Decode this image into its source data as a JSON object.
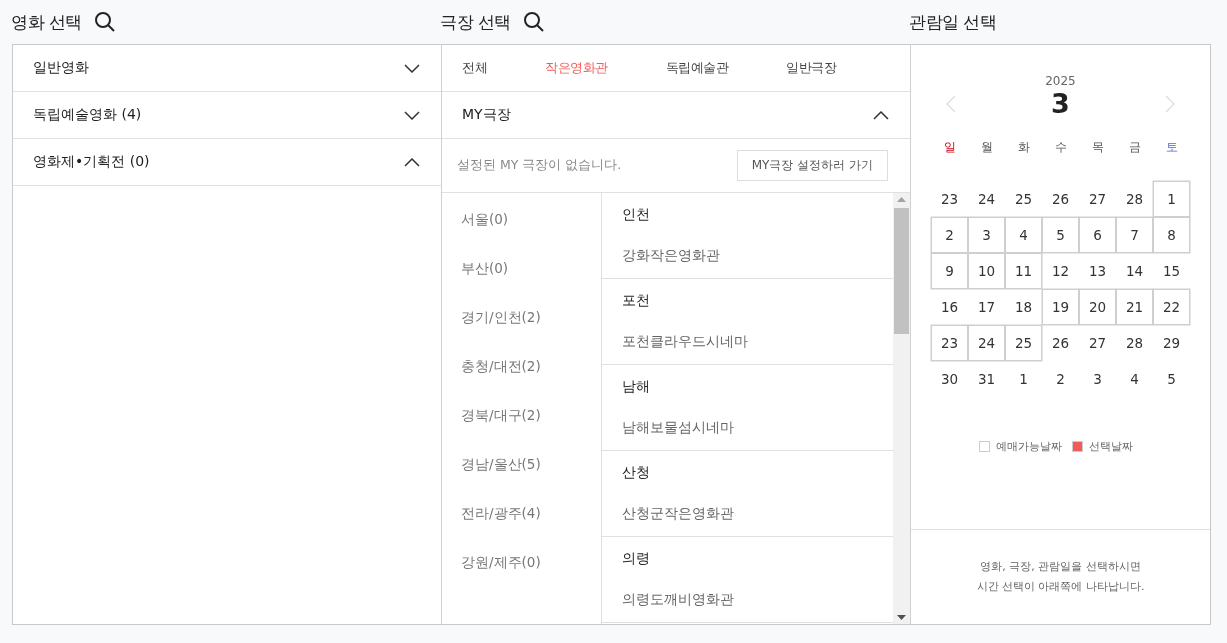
{
  "movie_panel": {
    "title": "영화 선택",
    "sections": [
      {
        "label": "일반영화",
        "expanded": false
      },
      {
        "label": "독립예술영화 (4)",
        "expanded": false
      },
      {
        "label": "영화제•기획전 (0)",
        "expanded": true
      }
    ]
  },
  "theater_panel": {
    "title": "극장 선택",
    "tabs": [
      {
        "label": "전체",
        "selected": false
      },
      {
        "label": "작은영화관",
        "selected": true
      },
      {
        "label": "독립예술관",
        "selected": false
      },
      {
        "label": "일반극장",
        "selected": false
      }
    ],
    "my_theater": {
      "label": "MY극장",
      "expanded": true,
      "notice": "설정된 MY 극장이 없습니다.",
      "button": "MY극장 설정하러 가기"
    },
    "regions": [
      {
        "label": "서울(0)",
        "selected": false
      },
      {
        "label": "부산(0)",
        "selected": false
      },
      {
        "label": "경기/인천(2)",
        "selected": false
      },
      {
        "label": "충청/대전(2)",
        "selected": false
      },
      {
        "label": "경북/대구(2)",
        "selected": false
      },
      {
        "label": "경남/울산(5)",
        "selected": false
      },
      {
        "label": "전라/광주(4)",
        "selected": false
      },
      {
        "label": "강원/제주(0)",
        "selected": false
      }
    ],
    "theaters": [
      {
        "area": "인천",
        "name": "강화작은영화관"
      },
      {
        "area": "포천",
        "name": "포천클라우드시네마"
      },
      {
        "area": "남해",
        "name": "남해보물섬시네마"
      },
      {
        "area": "산청",
        "name": "산청군작은영화관"
      },
      {
        "area": "의령",
        "name": "의령도깨비영화관"
      }
    ]
  },
  "date_panel": {
    "title": "관람일 선택",
    "year": "2025",
    "month": "3",
    "weekdays": [
      {
        "label": "일",
        "kind": "sunday"
      },
      {
        "label": "월",
        "kind": "weekday"
      },
      {
        "label": "화",
        "kind": "weekday"
      },
      {
        "label": "수",
        "kind": "weekday"
      },
      {
        "label": "목",
        "kind": "weekday"
      },
      {
        "label": "금",
        "kind": "weekday"
      },
      {
        "label": "토",
        "kind": "saturday"
      }
    ],
    "days": [
      {
        "label": "23",
        "available": false
      },
      {
        "label": "24",
        "available": false
      },
      {
        "label": "25",
        "available": false
      },
      {
        "label": "26",
        "available": false
      },
      {
        "label": "27",
        "available": false
      },
      {
        "label": "28",
        "available": false
      },
      {
        "label": "1",
        "available": true
      },
      {
        "label": "2",
        "available": true
      },
      {
        "label": "3",
        "available": true
      },
      {
        "label": "4",
        "available": true
      },
      {
        "label": "5",
        "available": true
      },
      {
        "label": "6",
        "available": true
      },
      {
        "label": "7",
        "available": true
      },
      {
        "label": "8",
        "available": true
      },
      {
        "label": "9",
        "available": true
      },
      {
        "label": "10",
        "available": true
      },
      {
        "label": "11",
        "available": true
      },
      {
        "label": "12",
        "available": false
      },
      {
        "label": "13",
        "available": false
      },
      {
        "label": "14",
        "available": false
      },
      {
        "label": "15",
        "available": false
      },
      {
        "label": "16",
        "available": false
      },
      {
        "label": "17",
        "available": false
      },
      {
        "label": "18",
        "available": false
      },
      {
        "label": "19",
        "available": true
      },
      {
        "label": "20",
        "available": true
      },
      {
        "label": "21",
        "available": true
      },
      {
        "label": "22",
        "available": true
      },
      {
        "label": "23",
        "available": true
      },
      {
        "label": "24",
        "available": true
      },
      {
        "label": "25",
        "available": true
      },
      {
        "label": "26",
        "available": false
      },
      {
        "label": "27",
        "available": false
      },
      {
        "label": "28",
        "available": false
      },
      {
        "label": "29",
        "available": false
      },
      {
        "label": "30",
        "available": false
      },
      {
        "label": "31",
        "available": false
      },
      {
        "label": "1",
        "available": false
      },
      {
        "label": "2",
        "available": false
      },
      {
        "label": "3",
        "available": false
      },
      {
        "label": "4",
        "available": false
      },
      {
        "label": "5",
        "available": false
      }
    ],
    "legend": [
      {
        "label": "예매가능날짜",
        "color": "#ffffff"
      },
      {
        "label": "선택날짜",
        "color": "#ef5d5a"
      }
    ],
    "guide": [
      "영화, 극장, 관람일을 선택하시면",
      "시간 선택이 아래쪽에 나타납니다."
    ]
  }
}
